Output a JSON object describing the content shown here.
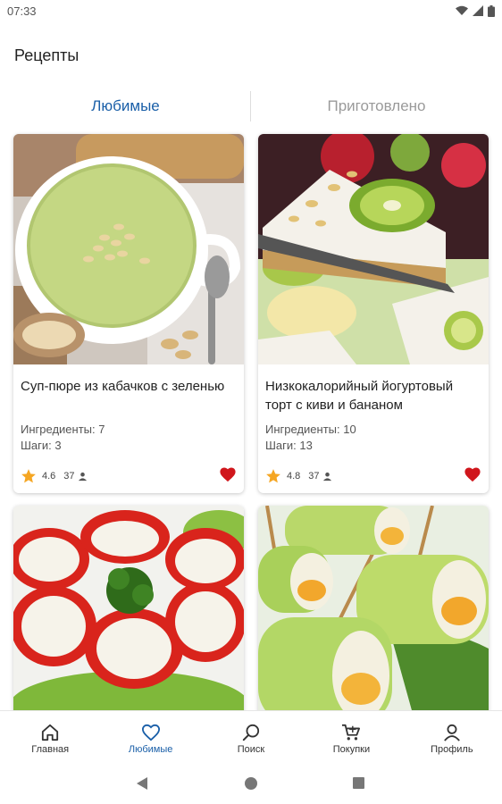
{
  "status_bar": {
    "time": "07:33",
    "icons": [
      "wifi-icon",
      "signal-icon",
      "battery-icon"
    ]
  },
  "app": {
    "title": "Рецепты"
  },
  "tabs": [
    {
      "label": "Любимые",
      "active": true
    },
    {
      "label": "Приготовлено",
      "active": false
    }
  ],
  "recipes": [
    {
      "title": "Суп-пюре из кабачков с зеленью",
      "ingredients": "Ингредиенты: 7",
      "steps": "Шаги: 3",
      "rating": "4.6",
      "reviews": "37",
      "favorite": true,
      "image": "zucchini-soup"
    },
    {
      "title": "Низкокалорийный йогуртовый торт с киви и бананом",
      "ingredients": "Ингредиенты: 10",
      "steps": "Шаги: 13",
      "rating": "4.8",
      "reviews": "37",
      "favorite": true,
      "image": "kiwi-yogurt-cake"
    },
    {
      "title": "",
      "image": "stuffed-peppers"
    },
    {
      "title": "",
      "image": "zucchini-rolls"
    }
  ],
  "bottom_nav": [
    {
      "label": "Главная",
      "icon": "home-icon",
      "active": false
    },
    {
      "label": "Любимые",
      "icon": "heart-outline-icon",
      "active": true
    },
    {
      "label": "Поиск",
      "icon": "search-icon",
      "active": false
    },
    {
      "label": "Покупки",
      "icon": "cart-icon",
      "active": false
    },
    {
      "label": "Профиль",
      "icon": "person-icon",
      "active": false
    }
  ],
  "colors": {
    "accent": "#1a5fa8",
    "favorite": "#d0161c",
    "star": "#f5a623",
    "inactive_tab": "#9a9a9a"
  }
}
